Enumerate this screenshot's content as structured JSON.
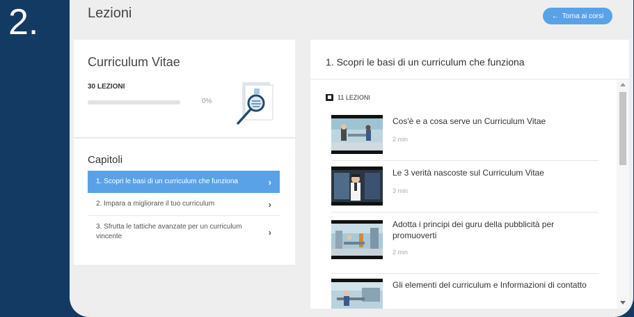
{
  "step_number": "2.",
  "header": {
    "title": "Lezioni",
    "back_button_label": "Torna ai corsi",
    "back_icon": "arrow-left-icon"
  },
  "course": {
    "title": "Curriculum Vitae",
    "lessons_count": "30 LEZIONI",
    "progress_label": "0%",
    "progress_fraction": 0
  },
  "chapters": {
    "title": "Capitoli",
    "items": [
      {
        "label": "1. Scopri le basi di un curriculum che funziona",
        "active": true
      },
      {
        "label": "2. Impara a migliorare il tuo curriculum",
        "active": false
      },
      {
        "label": "3. Sfrutta le tattiche avanzate per un curriculum vincente",
        "active": false
      }
    ]
  },
  "lessons_panel": {
    "title": "1. Scopri le basi di un curriculum che funziona",
    "count": "11 LEZIONI",
    "lessons": [
      {
        "title": "Cos'è e a cosa serve un Curriculum Vitae",
        "duration": "2 min"
      },
      {
        "title": "Le 3 verità nascoste sul Curriculum Vitae",
        "duration": "3 min"
      },
      {
        "title": "Adotta i principi dei guru della pubblicità per promuoverti",
        "duration": "2 min"
      },
      {
        "title": "Gli elementi del curriculum e Informazioni di contatto",
        "duration": ""
      }
    ]
  },
  "colors": {
    "page_background": "#123a63",
    "accent": "#5aa2e8",
    "frame": "#eeeeee"
  }
}
